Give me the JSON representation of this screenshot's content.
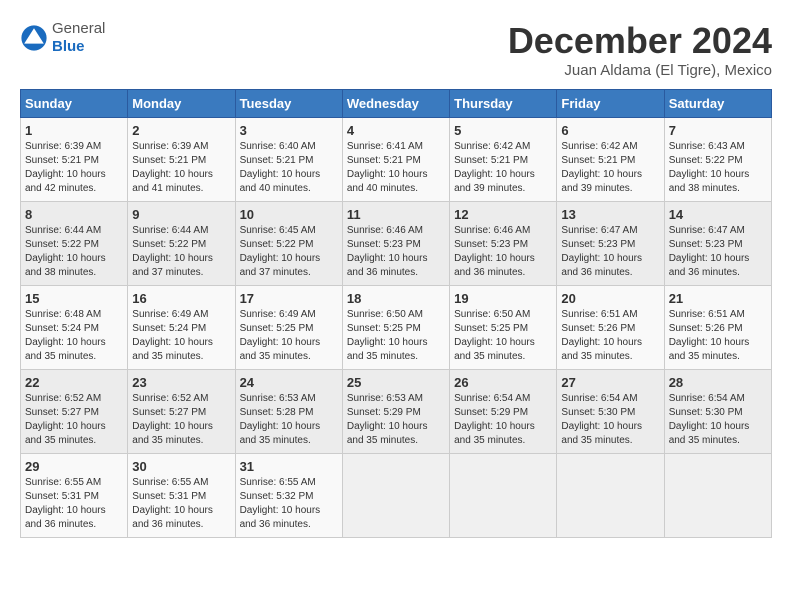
{
  "logo": {
    "general": "General",
    "blue": "Blue"
  },
  "title": "December 2024",
  "location": "Juan Aldama (El Tigre), Mexico",
  "days_of_week": [
    "Sunday",
    "Monday",
    "Tuesday",
    "Wednesday",
    "Thursday",
    "Friday",
    "Saturday"
  ],
  "weeks": [
    [
      {
        "day": "1",
        "info": "Sunrise: 6:39 AM\nSunset: 5:21 PM\nDaylight: 10 hours and 42 minutes."
      },
      {
        "day": "2",
        "info": "Sunrise: 6:39 AM\nSunset: 5:21 PM\nDaylight: 10 hours and 41 minutes."
      },
      {
        "day": "3",
        "info": "Sunrise: 6:40 AM\nSunset: 5:21 PM\nDaylight: 10 hours and 40 minutes."
      },
      {
        "day": "4",
        "info": "Sunrise: 6:41 AM\nSunset: 5:21 PM\nDaylight: 10 hours and 40 minutes."
      },
      {
        "day": "5",
        "info": "Sunrise: 6:42 AM\nSunset: 5:21 PM\nDaylight: 10 hours and 39 minutes."
      },
      {
        "day": "6",
        "info": "Sunrise: 6:42 AM\nSunset: 5:21 PM\nDaylight: 10 hours and 39 minutes."
      },
      {
        "day": "7",
        "info": "Sunrise: 6:43 AM\nSunset: 5:22 PM\nDaylight: 10 hours and 38 minutes."
      }
    ],
    [
      {
        "day": "8",
        "info": "Sunrise: 6:44 AM\nSunset: 5:22 PM\nDaylight: 10 hours and 38 minutes."
      },
      {
        "day": "9",
        "info": "Sunrise: 6:44 AM\nSunset: 5:22 PM\nDaylight: 10 hours and 37 minutes."
      },
      {
        "day": "10",
        "info": "Sunrise: 6:45 AM\nSunset: 5:22 PM\nDaylight: 10 hours and 37 minutes."
      },
      {
        "day": "11",
        "info": "Sunrise: 6:46 AM\nSunset: 5:23 PM\nDaylight: 10 hours and 36 minutes."
      },
      {
        "day": "12",
        "info": "Sunrise: 6:46 AM\nSunset: 5:23 PM\nDaylight: 10 hours and 36 minutes."
      },
      {
        "day": "13",
        "info": "Sunrise: 6:47 AM\nSunset: 5:23 PM\nDaylight: 10 hours and 36 minutes."
      },
      {
        "day": "14",
        "info": "Sunrise: 6:47 AM\nSunset: 5:23 PM\nDaylight: 10 hours and 36 minutes."
      }
    ],
    [
      {
        "day": "15",
        "info": "Sunrise: 6:48 AM\nSunset: 5:24 PM\nDaylight: 10 hours and 35 minutes."
      },
      {
        "day": "16",
        "info": "Sunrise: 6:49 AM\nSunset: 5:24 PM\nDaylight: 10 hours and 35 minutes."
      },
      {
        "day": "17",
        "info": "Sunrise: 6:49 AM\nSunset: 5:25 PM\nDaylight: 10 hours and 35 minutes."
      },
      {
        "day": "18",
        "info": "Sunrise: 6:50 AM\nSunset: 5:25 PM\nDaylight: 10 hours and 35 minutes."
      },
      {
        "day": "19",
        "info": "Sunrise: 6:50 AM\nSunset: 5:25 PM\nDaylight: 10 hours and 35 minutes."
      },
      {
        "day": "20",
        "info": "Sunrise: 6:51 AM\nSunset: 5:26 PM\nDaylight: 10 hours and 35 minutes."
      },
      {
        "day": "21",
        "info": "Sunrise: 6:51 AM\nSunset: 5:26 PM\nDaylight: 10 hours and 35 minutes."
      }
    ],
    [
      {
        "day": "22",
        "info": "Sunrise: 6:52 AM\nSunset: 5:27 PM\nDaylight: 10 hours and 35 minutes."
      },
      {
        "day": "23",
        "info": "Sunrise: 6:52 AM\nSunset: 5:27 PM\nDaylight: 10 hours and 35 minutes."
      },
      {
        "day": "24",
        "info": "Sunrise: 6:53 AM\nSunset: 5:28 PM\nDaylight: 10 hours and 35 minutes."
      },
      {
        "day": "25",
        "info": "Sunrise: 6:53 AM\nSunset: 5:29 PM\nDaylight: 10 hours and 35 minutes."
      },
      {
        "day": "26",
        "info": "Sunrise: 6:54 AM\nSunset: 5:29 PM\nDaylight: 10 hours and 35 minutes."
      },
      {
        "day": "27",
        "info": "Sunrise: 6:54 AM\nSunset: 5:30 PM\nDaylight: 10 hours and 35 minutes."
      },
      {
        "day": "28",
        "info": "Sunrise: 6:54 AM\nSunset: 5:30 PM\nDaylight: 10 hours and 35 minutes."
      }
    ],
    [
      {
        "day": "29",
        "info": "Sunrise: 6:55 AM\nSunset: 5:31 PM\nDaylight: 10 hours and 36 minutes."
      },
      {
        "day": "30",
        "info": "Sunrise: 6:55 AM\nSunset: 5:31 PM\nDaylight: 10 hours and 36 minutes."
      },
      {
        "day": "31",
        "info": "Sunrise: 6:55 AM\nSunset: 5:32 PM\nDaylight: 10 hours and 36 minutes."
      },
      null,
      null,
      null,
      null
    ]
  ]
}
